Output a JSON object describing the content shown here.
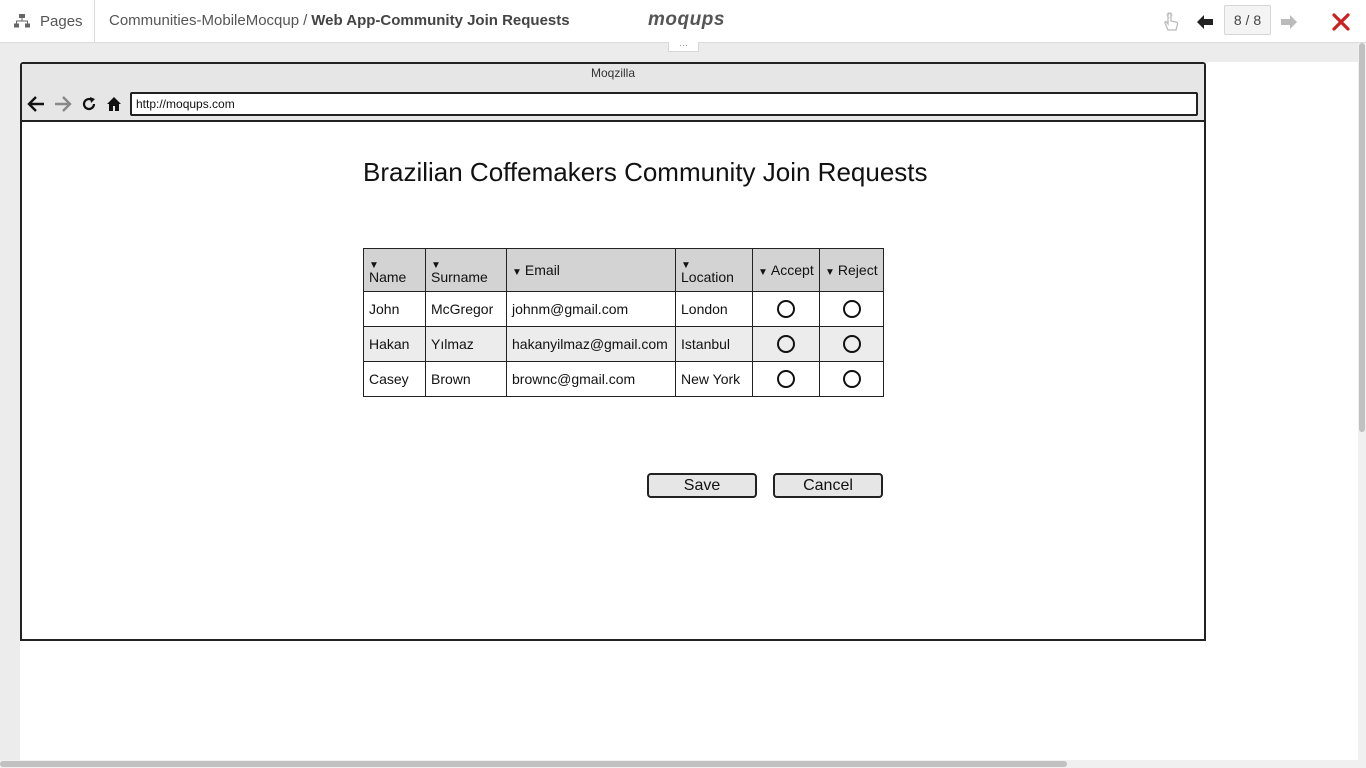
{
  "topbar": {
    "pages_label": "Pages",
    "project": "Communities-MobileMocqup",
    "separator": "/",
    "current_page": "Web App-Community Join Requests",
    "logo": "moqups",
    "page_counter": "8 / 8",
    "close_color": "#cc1f1f"
  },
  "browser": {
    "title": "Moqzilla",
    "url": "http://moqups.com"
  },
  "page": {
    "title": "Brazilian Coffemakers Community Join Requests",
    "table": {
      "headers": {
        "name": "Name",
        "surname": "Surname",
        "email": "Email",
        "location": "Location",
        "accept": "Accept",
        "reject": "Reject"
      },
      "sort_glyph": "▼",
      "rows": [
        {
          "name": "John",
          "surname": "McGregor",
          "email": "johnm@gmail.com",
          "location": "London"
        },
        {
          "name": "Hakan",
          "surname": "Yılmaz",
          "email": "hakanyilmaz@gmail.com",
          "location": "Istanbul"
        },
        {
          "name": "Casey",
          "surname": "Brown",
          "email": "brownc@gmail.com",
          "location": "New York"
        }
      ]
    },
    "save_label": "Save",
    "cancel_label": "Cancel"
  }
}
